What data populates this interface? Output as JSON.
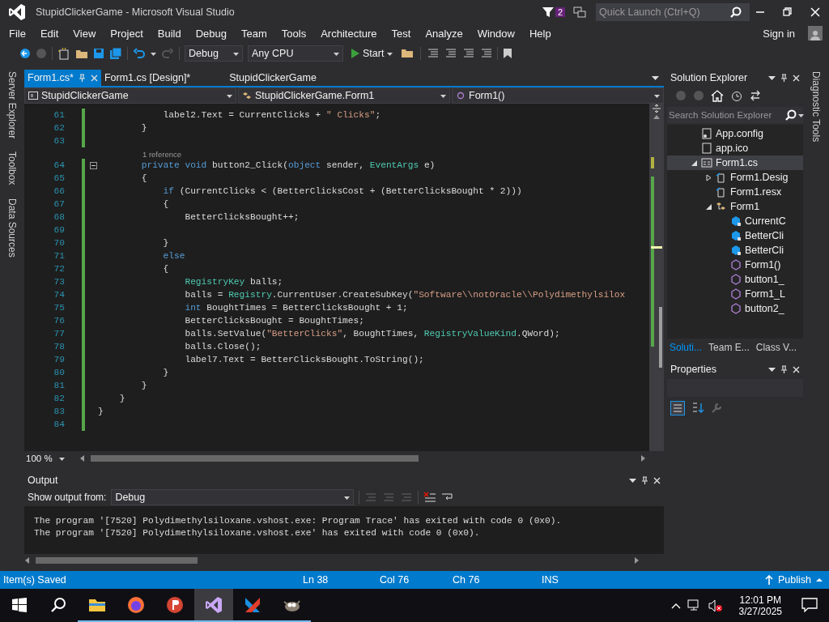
{
  "window": {
    "title": "StupidClickerGame - Microsoft Visual Studio",
    "notification_count": "2",
    "quick_launch": {
      "placeholder": "Quick Launch (Ctrl+Q)"
    }
  },
  "menu": [
    "File",
    "Edit",
    "View",
    "Project",
    "Build",
    "Debug",
    "Team",
    "Tools",
    "Architecture",
    "Test",
    "Analyze",
    "Window",
    "Help"
  ],
  "sign_in": "Sign in",
  "toolbar": {
    "configuration": "Debug",
    "platform": "Any CPU",
    "start": "Start"
  },
  "left_tabs": [
    "Server Explorer",
    "Toolbox",
    "Data Sources"
  ],
  "right_tabs": [
    "Diagnostic Tools"
  ],
  "editor_tabs": [
    {
      "label": "Form1.cs*",
      "selected": true
    },
    {
      "label": "Form1.cs [Design]*",
      "selected": false
    },
    {
      "label": "StupidClickerGame",
      "selected": false
    }
  ],
  "navigation": [
    "StupidClickerGame",
    "StupidClickerGame.Form1",
    "Form1()"
  ],
  "code": {
    "lines": [
      {
        "number": "61",
        "tokens": [
          {
            "text": "            label2.Text = CurrentClicks + ",
            "kind": "plain"
          },
          {
            "text": "\" Clicks\"",
            "kind": "str"
          },
          {
            "text": ";",
            "kind": "plain"
          }
        ]
      },
      {
        "number": "62",
        "tokens": [
          {
            "text": "        }",
            "kind": "plain"
          }
        ]
      },
      {
        "number": "63"
      },
      {
        "number": "64",
        "lens": "1 reference",
        "collapsible": true,
        "tokens": [
          {
            "text": "        private void",
            "kind": "kw"
          },
          {
            "text": " button2_Click(",
            "kind": "plain"
          },
          {
            "text": "object",
            "kind": "kw"
          },
          {
            "text": " sender, ",
            "kind": "plain"
          },
          {
            "text": "EventArgs",
            "kind": "type"
          },
          {
            "text": " e)",
            "kind": "plain"
          }
        ]
      },
      {
        "number": "65",
        "tokens": [
          {
            "text": "        {",
            "kind": "plain"
          }
        ]
      },
      {
        "number": "66",
        "tokens": [
          {
            "text": "            if",
            "kind": "kw"
          },
          {
            "text": " (CurrentClicks < (BetterClicksCost + (BetterClicksBought * 2)))",
            "kind": "plain"
          }
        ]
      },
      {
        "number": "67",
        "tokens": [
          {
            "text": "            {",
            "kind": "plain"
          }
        ]
      },
      {
        "number": "68",
        "tokens": [
          {
            "text": "                BetterClicksBought++;",
            "kind": "plain"
          }
        ]
      },
      {
        "number": "69"
      },
      {
        "number": "70",
        "tokens": [
          {
            "text": "            }",
            "kind": "plain"
          }
        ]
      },
      {
        "number": "71",
        "tokens": [
          {
            "text": "            else",
            "kind": "kw"
          }
        ]
      },
      {
        "number": "72",
        "tokens": [
          {
            "text": "            {",
            "kind": "plain"
          }
        ]
      },
      {
        "number": "73",
        "tokens": [
          {
            "text": "                RegistryKey",
            "kind": "type"
          },
          {
            "text": " balls;",
            "kind": "plain"
          }
        ]
      },
      {
        "number": "74",
        "tokens": [
          {
            "text": "                balls = ",
            "kind": "plain"
          },
          {
            "text": "Registry",
            "kind": "type"
          },
          {
            "text": ".CurrentUser.CreateSubKey(",
            "kind": "plain"
          },
          {
            "text": "\"Software\\\\notOracle\\\\Polydimethylsilox",
            "kind": "str"
          }
        ]
      },
      {
        "number": "75",
        "tokens": [
          {
            "text": "                int",
            "kind": "kw"
          },
          {
            "text": " BoughtTimes = BetterClicksBought + 1;",
            "kind": "plain"
          }
        ]
      },
      {
        "number": "76",
        "tokens": [
          {
            "text": "                BetterClicksBought = BoughtTimes;",
            "kind": "plain"
          }
        ]
      },
      {
        "number": "77",
        "tokens": [
          {
            "text": "                balls.SetValue(",
            "kind": "plain"
          },
          {
            "text": "\"BetterClicks\"",
            "kind": "str"
          },
          {
            "text": ", BoughtTimes, ",
            "kind": "plain"
          },
          {
            "text": "RegistryValueKind",
            "kind": "type"
          },
          {
            "text": ".QWord);",
            "kind": "plain"
          }
        ]
      },
      {
        "number": "78",
        "tokens": [
          {
            "text": "                balls.Close();",
            "kind": "plain"
          }
        ]
      },
      {
        "number": "79",
        "tokens": [
          {
            "text": "                label7.Text = BetterClicksBought.ToString();",
            "kind": "plain"
          }
        ]
      },
      {
        "number": "80",
        "tokens": [
          {
            "text": "            }",
            "kind": "plain"
          }
        ]
      },
      {
        "number": "81",
        "tokens": [
          {
            "text": "        }",
            "kind": "plain"
          }
        ]
      },
      {
        "number": "82",
        "tokens": [
          {
            "text": "    }",
            "kind": "plain"
          }
        ]
      },
      {
        "number": "83",
        "tokens": [
          {
            "text": "}",
            "kind": "plain"
          }
        ]
      },
      {
        "number": "84"
      }
    ]
  },
  "zoom": "100 %",
  "output": {
    "title": "Output",
    "source_label": "Show output from:",
    "source": "Debug",
    "lines": [
      "The program '[7520] Polydimethylsiloxane.vshost.exe: Program Trace' has exited with code 0 (0x0).",
      "The program '[7520] Polydimethylsiloxane.vshost.exe' has exited with code 0 (0x0)."
    ]
  },
  "solution_explorer": {
    "title": "Solution Explorer",
    "search": {
      "placeholder": "Search Solution Explorer"
    },
    "tree": [
      {
        "label": "App.config",
        "kind": "config",
        "selected": false
      },
      {
        "label": "app.ico",
        "kind": "file",
        "selected": false
      },
      {
        "label": "Form1.cs",
        "kind": "form",
        "selected": true,
        "expanded": true,
        "children": [
          {
            "label": "Form1.Desig",
            "kind": "code",
            "selected": false,
            "expanded": false
          },
          {
            "label": "Form1.resx",
            "kind": "code",
            "selected": false
          },
          {
            "label": "Form1",
            "kind": "class",
            "selected": false,
            "expanded": true,
            "children": [
              {
                "label": "CurrentC",
                "kind": "field",
                "selected": false
              },
              {
                "label": "BetterCli",
                "kind": "field",
                "selected": false
              },
              {
                "label": "BetterCli",
                "kind": "field",
                "selected": false
              },
              {
                "label": "Form1()",
                "kind": "method",
                "selected": false
              },
              {
                "label": "button1_",
                "kind": "method",
                "selected": false
              },
              {
                "label": "Form1_L",
                "kind": "method",
                "selected": false
              },
              {
                "label": "button2_",
                "kind": "method",
                "selected": false
              }
            ]
          }
        ]
      }
    ]
  },
  "panel_tabs": [
    {
      "label": "Soluti...",
      "selected": true
    },
    {
      "label": "Team E...",
      "selected": false
    },
    {
      "label": "Class V...",
      "selected": false
    }
  ],
  "properties": {
    "title": "Properties"
  },
  "status_bar": {
    "message": "Item(s) Saved",
    "line": "Ln 38",
    "col": "Col 76",
    "ch": "Ch 76",
    "mode": "INS",
    "publish": "Publish"
  },
  "taskbar": {
    "apps": [
      {
        "kind": "folder",
        "selected": false
      },
      {
        "kind": "browser",
        "selected": false
      },
      {
        "kind": "paint",
        "selected": false
      },
      {
        "kind": "studio",
        "selected": true
      },
      {
        "kind": "editor",
        "selected": false
      },
      {
        "kind": "gimp",
        "selected": false
      }
    ],
    "time": "12:01 PM",
    "date": "3/27/2025"
  }
}
